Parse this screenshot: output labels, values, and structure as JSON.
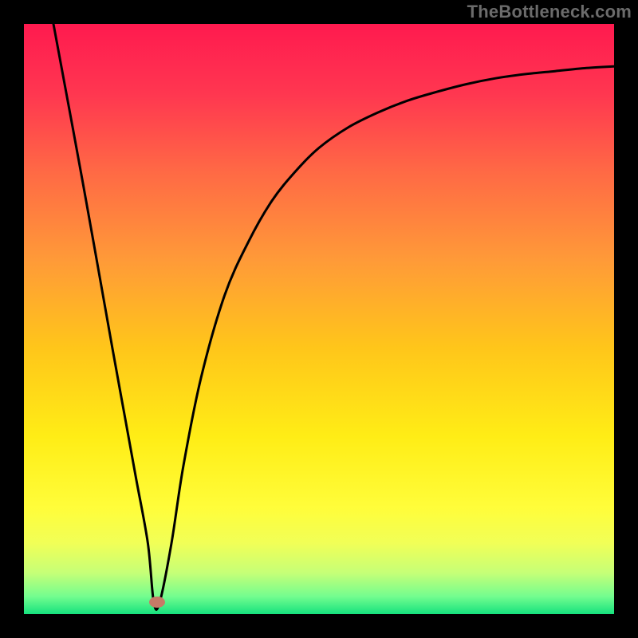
{
  "watermark": {
    "text": "TheBottleneck.com",
    "color": "#6b6b6b"
  },
  "chart_data": {
    "type": "line",
    "title": "",
    "xlabel": "",
    "ylabel": "",
    "xlim": [
      0,
      100
    ],
    "ylim": [
      0,
      100
    ],
    "grid": false,
    "legend": false,
    "series": [
      {
        "name": "bottleneck-curve",
        "x": [
          5,
          10,
          15,
          17,
          19,
          21,
          22,
          23,
          25,
          27,
          30,
          34,
          38,
          42,
          46,
          50,
          55,
          60,
          65,
          70,
          75,
          80,
          85,
          90,
          95,
          100
        ],
        "values": [
          100,
          73,
          45,
          34,
          23,
          12,
          2,
          2,
          12,
          25,
          40,
          54,
          63,
          70,
          75,
          79,
          82.5,
          85,
          87,
          88.5,
          89.8,
          90.8,
          91.5,
          92,
          92.5,
          92.8
        ]
      }
    ],
    "min_point": {
      "x": 22.5,
      "y": 2
    },
    "background_gradient_stops": [
      {
        "offset": 0.0,
        "color": "#ff1a4f"
      },
      {
        "offset": 0.12,
        "color": "#ff3750"
      },
      {
        "offset": 0.25,
        "color": "#ff6945"
      },
      {
        "offset": 0.4,
        "color": "#ff9a38"
      },
      {
        "offset": 0.55,
        "color": "#ffc61a"
      },
      {
        "offset": 0.7,
        "color": "#ffed16"
      },
      {
        "offset": 0.82,
        "color": "#fffd3a"
      },
      {
        "offset": 0.88,
        "color": "#f1ff57"
      },
      {
        "offset": 0.93,
        "color": "#c6ff77"
      },
      {
        "offset": 0.97,
        "color": "#74fd8f"
      },
      {
        "offset": 1.0,
        "color": "#16e27e"
      }
    ],
    "marker_color": "#c77a67",
    "curve_color": "#000000"
  }
}
